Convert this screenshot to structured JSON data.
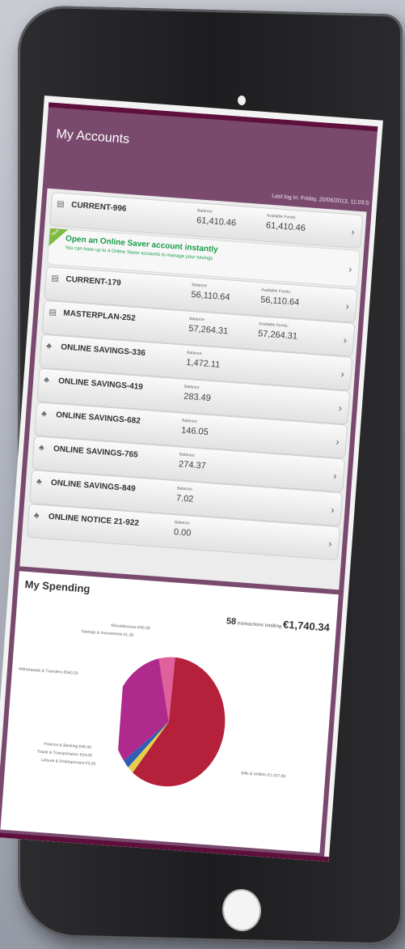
{
  "header": {
    "title": "My Accounts",
    "last_login": "Last log in: Friday, 20/06/2013, 11:03:5"
  },
  "labels": {
    "balance": "Balance:",
    "available_funds": "Available Funds:"
  },
  "accounts": [
    {
      "name": "CURRENT-996",
      "balance": "61,410.46",
      "available": "61,410.46",
      "icon": "card-icon"
    },
    {
      "name": "CURRENT-179",
      "balance": "56,110.64",
      "available": "56,110.64",
      "icon": "card-icon"
    },
    {
      "name": "MASTERPLAN-252",
      "balance": "57,264.31",
      "available": "57,264.31",
      "icon": "card-icon"
    },
    {
      "name": "ONLINE SAVINGS-336",
      "balance": "1,472.11",
      "icon": "piggy-bank-icon"
    },
    {
      "name": "ONLINE SAVINGS-419",
      "balance": "283.49",
      "icon": "piggy-bank-icon"
    },
    {
      "name": "ONLINE SAVINGS-682",
      "balance": "146.05",
      "icon": "piggy-bank-icon"
    },
    {
      "name": "ONLINE SAVINGS-765",
      "balance": "274.37",
      "icon": "piggy-bank-icon"
    },
    {
      "name": "ONLINE SAVINGS-849",
      "balance": "7.02",
      "icon": "piggy-bank-icon"
    },
    {
      "name": "ONLINE NOTICE 21-922",
      "balance": "0.00",
      "icon": "piggy-bank-icon"
    }
  ],
  "promo": {
    "badge": "New",
    "headline": "Open an Online Saver account instantly",
    "subtext": "You can have up to 4 Online Saver accounts to manage your savings"
  },
  "spending": {
    "title": "My Spending",
    "count": "58",
    "count_label": "transactions totalling",
    "total": "€1,740.34",
    "labels": {
      "misc": "Miscellaneous €90.33",
      "savings": "Savings & Investments €1.30",
      "withdrawals": "Withdrawals & Transfers €560.29",
      "finance": "Finance & Banking €46.00",
      "travel": "Travel & Transportation €24.00",
      "leisure": "Leisure & Entertainment €3.00",
      "bills": "Bills & Utilities €1,027.84"
    },
    "colors": {
      "bills": "#b5213a",
      "withdrawals": "#b02a8e",
      "misc": "#e0609c",
      "finance": "#2e5fb5",
      "travel": "#e5cf4a",
      "leisure": "#8ab04a",
      "savings": "#c77cc9"
    }
  }
}
